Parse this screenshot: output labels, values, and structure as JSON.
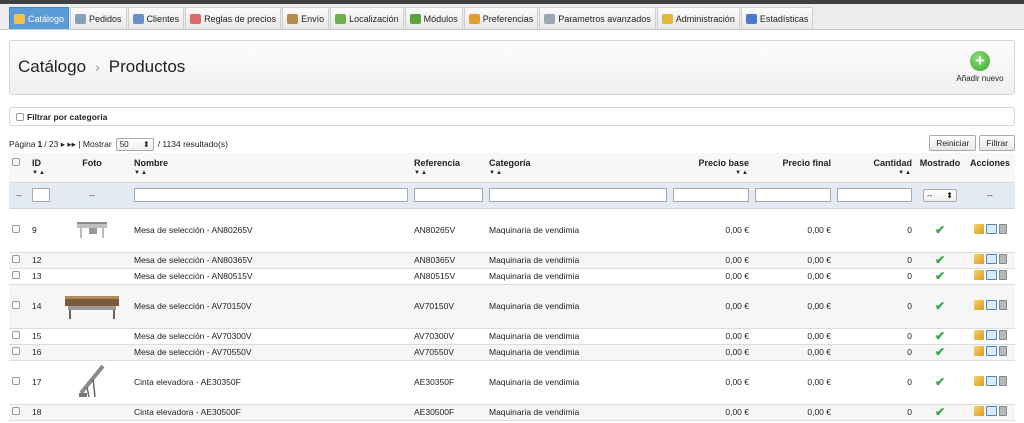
{
  "tabs": [
    {
      "label": "Catálogo",
      "icon": "folder-icon",
      "color": "#f2c14e"
    },
    {
      "label": "Pedidos",
      "icon": "cart-icon",
      "color": "#8aa0b8"
    },
    {
      "label": "Clientes",
      "icon": "user-icon",
      "color": "#6a8fc7"
    },
    {
      "label": "Reglas de precios",
      "icon": "price-rules-icon",
      "color": "#d96b6b"
    },
    {
      "label": "Envío",
      "icon": "truck-icon",
      "color": "#b58a4a"
    },
    {
      "label": "Localización",
      "icon": "globe-icon",
      "color": "#6fb04a"
    },
    {
      "label": "Módulos",
      "icon": "puzzle-icon",
      "color": "#5aa33a"
    },
    {
      "label": "Preferencias",
      "icon": "preferences-icon",
      "color": "#e0a030"
    },
    {
      "label": "Parametros avanzados",
      "icon": "wrench-icon",
      "color": "#9aa6b4"
    },
    {
      "label": "Administración",
      "icon": "key-icon",
      "color": "#e2b83a"
    },
    {
      "label": "Estadísticas",
      "icon": "stats-icon",
      "color": "#4a7ad0"
    }
  ],
  "header": {
    "section": "Catálogo",
    "separator": "›",
    "page": "Productos",
    "add_label": "Añadir nuevo",
    "add_glyph": "+"
  },
  "filter": {
    "label": "Filtrar por categoría"
  },
  "pager": {
    "page_prefix": "Página",
    "current": "1",
    "total": "/ 23",
    "next_glyphs": "▸ ▸▸",
    "show_label": "| Mostrar",
    "per_page": "50",
    "results": "/ 1134 resultado(s)"
  },
  "buttons": {
    "reset": "Reiniciar",
    "filter": "Filtrar"
  },
  "columns": {
    "id": "ID",
    "photo": "Foto",
    "name": "Nombre",
    "reference": "Referencia",
    "category": "Categoría",
    "base_price": "Precio base",
    "final_price": "Precio final",
    "quantity": "Cantidad",
    "shown": "Mostrado",
    "actions": "Acciones",
    "sort_glyph": "▼▲",
    "dash": "--",
    "select_value": "--"
  },
  "rows": [
    {
      "id": "9",
      "photo": "conveyor-table",
      "name": "Mesa de selección - AN80265V",
      "reference": "AN80265V",
      "category": "Maquinaria de vendimia",
      "base_price": "0,00 €",
      "final_price": "0,00 €",
      "quantity": "0",
      "shown": "✔"
    },
    {
      "id": "12",
      "photo": "",
      "name": "Mesa de selección - AN80365V",
      "reference": "AN80365V",
      "category": "Maquinaria de vendimia",
      "base_price": "0,00 €",
      "final_price": "0,00 €",
      "quantity": "0",
      "shown": "✔"
    },
    {
      "id": "13",
      "photo": "",
      "name": "Mesa de selección - AN80515V",
      "reference": "AN80515V",
      "category": "Maquinaria de vendimia",
      "base_price": "0,00 €",
      "final_price": "0,00 €",
      "quantity": "0",
      "shown": "✔"
    },
    {
      "id": "14",
      "photo": "sorting-table",
      "name": "Mesa de selección - AV70150V",
      "reference": "AV70150V",
      "category": "Maquinaria de vendimia",
      "base_price": "0,00 €",
      "final_price": "0,00 €",
      "quantity": "0",
      "shown": "✔"
    },
    {
      "id": "15",
      "photo": "",
      "name": "Mesa de selección - AV70300V",
      "reference": "AV70300V",
      "category": "Maquinaria de vendimia",
      "base_price": "0,00 €",
      "final_price": "0,00 €",
      "quantity": "0",
      "shown": "✔"
    },
    {
      "id": "16",
      "photo": "",
      "name": "Mesa de selección - AV70550V",
      "reference": "AV70550V",
      "category": "Maquinaria de vendimia",
      "base_price": "0,00 €",
      "final_price": "0,00 €",
      "quantity": "0",
      "shown": "✔"
    },
    {
      "id": "17",
      "photo": "elevator-belt",
      "name": "Cinta elevadora - AE30350F",
      "reference": "AE30350F",
      "category": "Maquinaria de vendimia",
      "base_price": "0,00 €",
      "final_price": "0,00 €",
      "quantity": "0",
      "shown": "✔"
    },
    {
      "id": "18",
      "photo": "",
      "name": "Cinta elevadora - AE30500F",
      "reference": "AE30500F",
      "category": "Maquinaria de vendimia",
      "base_price": "0,00 €",
      "final_price": "0,00 €",
      "quantity": "0",
      "shown": "✔"
    }
  ]
}
